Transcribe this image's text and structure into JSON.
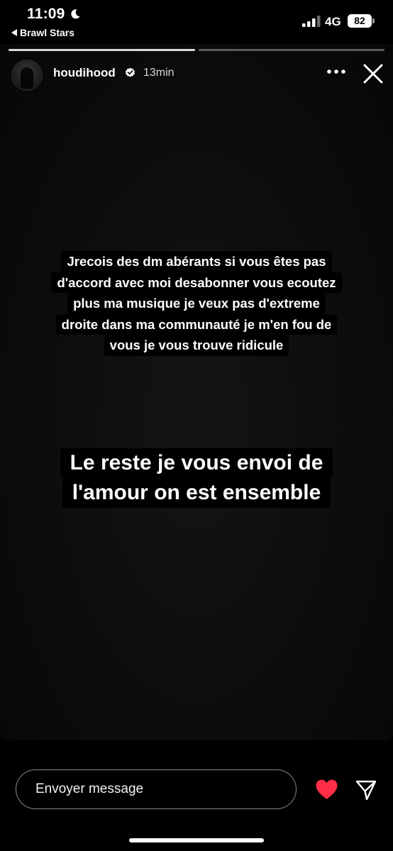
{
  "status_bar": {
    "time": "11:09",
    "back_app": "Brawl Stars",
    "network": "4G",
    "battery": "82",
    "icons": [
      "moon-icon",
      "signal-icon",
      "battery-icon"
    ]
  },
  "story": {
    "username": "houdihood",
    "age": "13min",
    "verified": true,
    "segments_total": 2,
    "segment_current": 1,
    "text_block_1": [
      "Jrecois des dm abérants si vous êtes pas",
      "d'accord avec moi desabonner vous ecoutez",
      "plus ma musique je veux pas d'extreme",
      "droite dans ma communauté je m'en fou de",
      "vous je vous trouve ridicule"
    ],
    "text_block_2": [
      "Le reste je vous envoi de",
      "l'amour on est ensemble"
    ],
    "icons": [
      "avatar",
      "verified-badge-icon",
      "more-icon",
      "close-icon"
    ]
  },
  "reply_bar": {
    "placeholder": "Envoyer message",
    "icons": [
      "heart-icon",
      "send-icon"
    ],
    "heart_color": "#ff2d46"
  },
  "colors": {
    "background": "#000000",
    "progress_active": "#d8d8d8",
    "progress_inactive": "#5a5a5a"
  }
}
